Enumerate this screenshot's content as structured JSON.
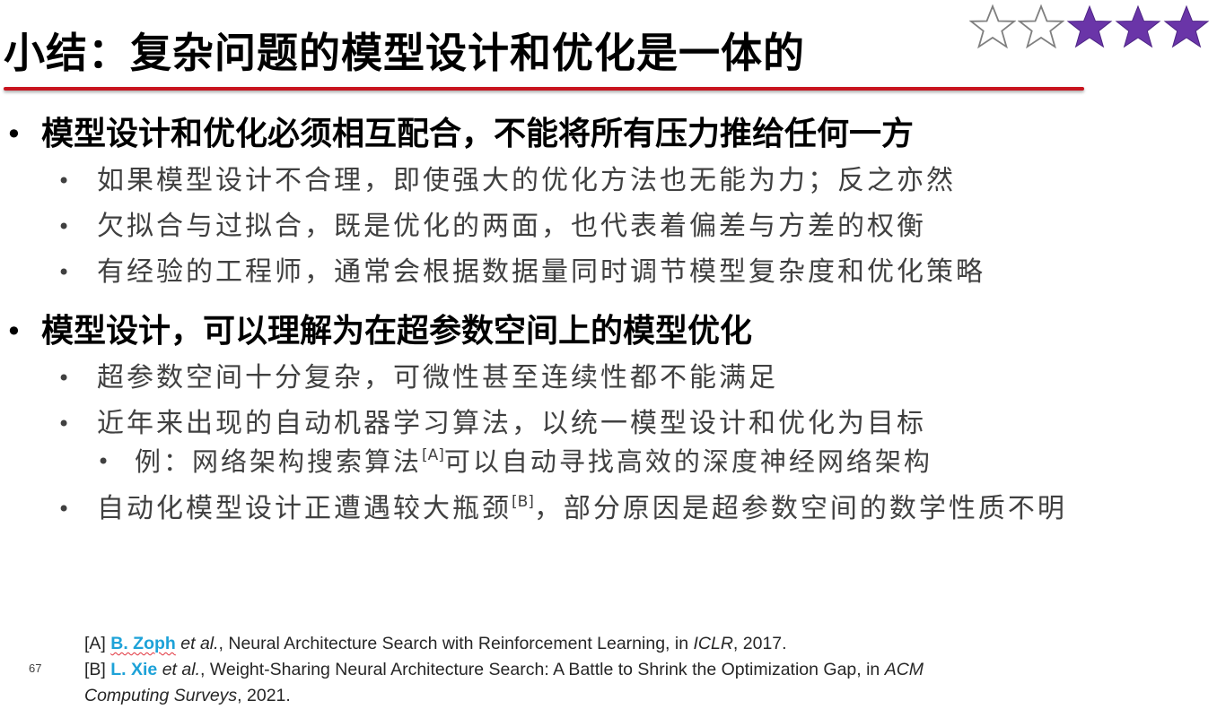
{
  "slide": {
    "title": "小结：复杂问题的模型设计和优化是一体的",
    "page_number": "67",
    "accent_color": "#c8141e",
    "rating": {
      "filled": 3,
      "total": 5,
      "star_color": "#6a35a8"
    }
  },
  "bullets": {
    "b1": {
      "text": "模型设计和优化必须相互配合，不能将所有压力推给任何一方",
      "children": [
        "如果模型设计不合理，即使强大的优化方法也无能为力；反之亦然",
        "欠拟合与过拟合，既是优化的两面，也代表着偏差与方差的权衡",
        "有经验的工程师，通常会根据数据量同时调节模型复杂度和优化策略"
      ]
    },
    "b2": {
      "text": "模型设计，可以理解为在超参数空间上的模型优化",
      "c1": "超参数空间十分复杂，可微性甚至连续性都不能满足",
      "c2": "近年来出现的自动机器学习算法，以统一模型设计和优化为目标",
      "c2_sub": {
        "before": "例：网络架构搜索算法",
        "ref": "[A]",
        "after": "可以自动寻找高效的深度神经网络架构"
      },
      "c3": {
        "before": "自动化模型设计正遭遇较大瓶颈",
        "ref": "[B]",
        "after": "，部分原因是超参数空间的数学性质不明"
      }
    }
  },
  "references": {
    "a": {
      "label": "[A] ",
      "author": "B. Zoph",
      "etal": " et al.",
      "rest": ", Neural Architecture Search with Reinforcement Learning, in ",
      "venue": "ICLR",
      "year": ", 2017."
    },
    "b": {
      "label": "[B] ",
      "author": "L. Xie",
      "etal": " et al.",
      "rest": ", Weight-Sharing Neural Architecture Search: A Battle to Shrink the Optimization Gap, in ",
      "venue_line1": "ACM",
      "venue_line2": "Computing Surveys",
      "year": ", 2021."
    }
  }
}
